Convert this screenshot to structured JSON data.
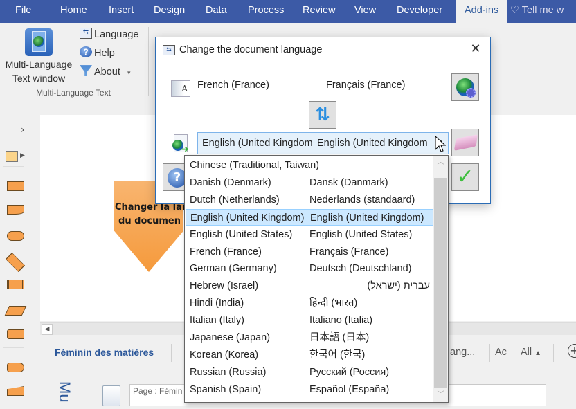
{
  "ribbon_tabs": [
    {
      "label": "File"
    },
    {
      "label": "Home"
    },
    {
      "label": "Insert"
    },
    {
      "label": "Design"
    },
    {
      "label": "Data"
    },
    {
      "label": "Process"
    },
    {
      "label": "Review"
    },
    {
      "label": "View"
    },
    {
      "label": "Developer"
    },
    {
      "label": "Add-ins",
      "active": true
    }
  ],
  "tell_me": "Tell me w",
  "ribbon": {
    "big_button_line1": "Multi-Language",
    "big_button_line2": "Text window",
    "language_label": "Language",
    "help_label": "Help",
    "about_label": "About",
    "group_label": "Multi-Language Text"
  },
  "canvas": {
    "shape_text_line1": "Changer la lan",
    "shape_text_line2": "du documen"
  },
  "bottom_bar": {
    "title": "Féminin des matières",
    "partial_item": "ang...",
    "ac_item": "Ac",
    "all_filter": "All",
    "page_field": "Page : Fémin",
    "vertical_label": "Mu"
  },
  "dialog": {
    "title": "Change the document language",
    "source_language": "French (France)",
    "source_native": "Français (France)",
    "target_language": "English (United Kingdom",
    "target_native": "English (United Kingdom"
  },
  "dropdown": {
    "options": [
      {
        "name": "Chinese (Traditional, Taiwan)",
        "native": ""
      },
      {
        "name": "Danish (Denmark)",
        "native": "Dansk (Danmark)"
      },
      {
        "name": "Dutch (Netherlands)",
        "native": "Nederlands (standaard)"
      },
      {
        "name": "English (United Kingdom)",
        "native": "English (United Kingdom)",
        "selected": true
      },
      {
        "name": "English (United States)",
        "native": "English (United States)"
      },
      {
        "name": "French (France)",
        "native": "Français (France)"
      },
      {
        "name": "German (Germany)",
        "native": "Deutsch (Deutschland)"
      },
      {
        "name": "Hebrew (Israel)",
        "native": "עברית (ישראל)",
        "rtl": true
      },
      {
        "name": "Hindi (India)",
        "native": "हिन्दी (भारत)"
      },
      {
        "name": "Italian (Italy)",
        "native": "Italiano (Italia)"
      },
      {
        "name": "Japanese (Japan)",
        "native": "日本語 (日本)"
      },
      {
        "name": "Korean (Korea)",
        "native": "한국어 (한국)"
      },
      {
        "name": "Russian (Russia)",
        "native": "Русский (Россия)"
      },
      {
        "name": "Spanish (Spain)",
        "native": "Español (España)"
      }
    ]
  },
  "colors": {
    "ribbon_blue": "#3c5aa6",
    "selection": "#cce8ff",
    "shape_orange": "#f59a3c"
  }
}
